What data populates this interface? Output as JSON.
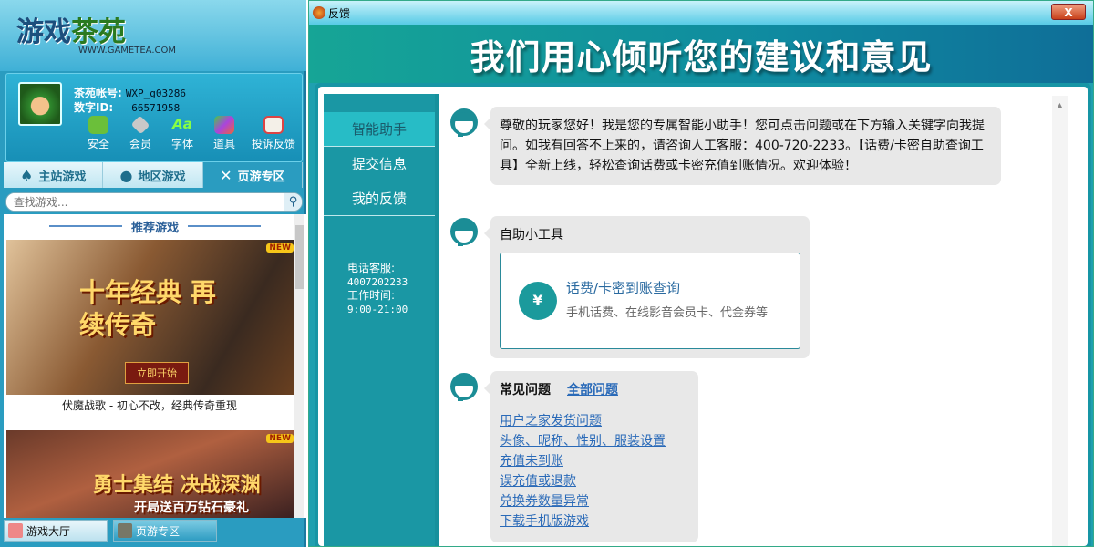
{
  "left": {
    "logo": {
      "brand_a": "游戏",
      "brand_b": "茶苑",
      "url": "WWW.GAMETEA.COM"
    },
    "user": {
      "account_label": "茶苑帐号:",
      "account": "WXP_g03286",
      "id_label": "数字ID:",
      "id": "66571958"
    },
    "user_icons": [
      {
        "label": "安全",
        "color": "#6bbf3a"
      },
      {
        "label": "会员",
        "color": "#c0c0c0"
      },
      {
        "label": "字体",
        "color": "#7fd04a"
      },
      {
        "label": "道具",
        "color": "#a050d0"
      },
      {
        "label": "投诉反馈",
        "color": "#e06040"
      }
    ],
    "tabs": [
      {
        "label": "主站游戏",
        "icon": "♠"
      },
      {
        "label": "地区游戏",
        "icon": "👤"
      },
      {
        "label": "页游专区",
        "icon": "✕"
      }
    ],
    "search_placeholder": "查找游戏...",
    "section_title": "推荐游戏",
    "games": [
      {
        "title_art": "十年经典 再续传奇",
        "badge": "NEW",
        "caption": "伏魔战歌 - 初心不改，经典传奇重现",
        "cta": "立即开始"
      },
      {
        "title_art": "勇士集结 决战深渊",
        "sub_art": "开局送百万钻石豪礼",
        "badge": "NEW"
      }
    ],
    "bottom_tabs": [
      "游戏大厅",
      "页游专区"
    ]
  },
  "window": {
    "title": "反馈",
    "close": "X",
    "hero": "我们用心倾听您的建议和意见",
    "nav": [
      "智能助手",
      "提交信息",
      "我的反馈"
    ],
    "contact": {
      "phone_label": "电话客服:",
      "phone": "4007202233",
      "hours_label": "工作时间:",
      "hours": "9:00-21:00"
    },
    "welcome": "尊敬的玩家您好！我是您的专属智能小助手！您可点击问题或在下方输入关键字向我提问。如我有回答不上来的，请咨询人工客服：400-720-2233。【话费/卡密自助查询工具】全新上线，轻松查询话费或卡密充值到账情况。欢迎体验！",
    "tools_title": "自助小工具",
    "tool": {
      "icon": "¥",
      "title": "话费/卡密到账查询",
      "subtitle": "手机话费、在线影音会员卡、代金券等"
    },
    "faq_title": "常见问题",
    "faq_all": "全部问题",
    "faq": [
      "用户之家发货问题",
      "头像、昵称、性别、服装设置",
      "充值未到账",
      "误充值或退款",
      "兑换券数量异常",
      "下载手机版游戏"
    ]
  }
}
